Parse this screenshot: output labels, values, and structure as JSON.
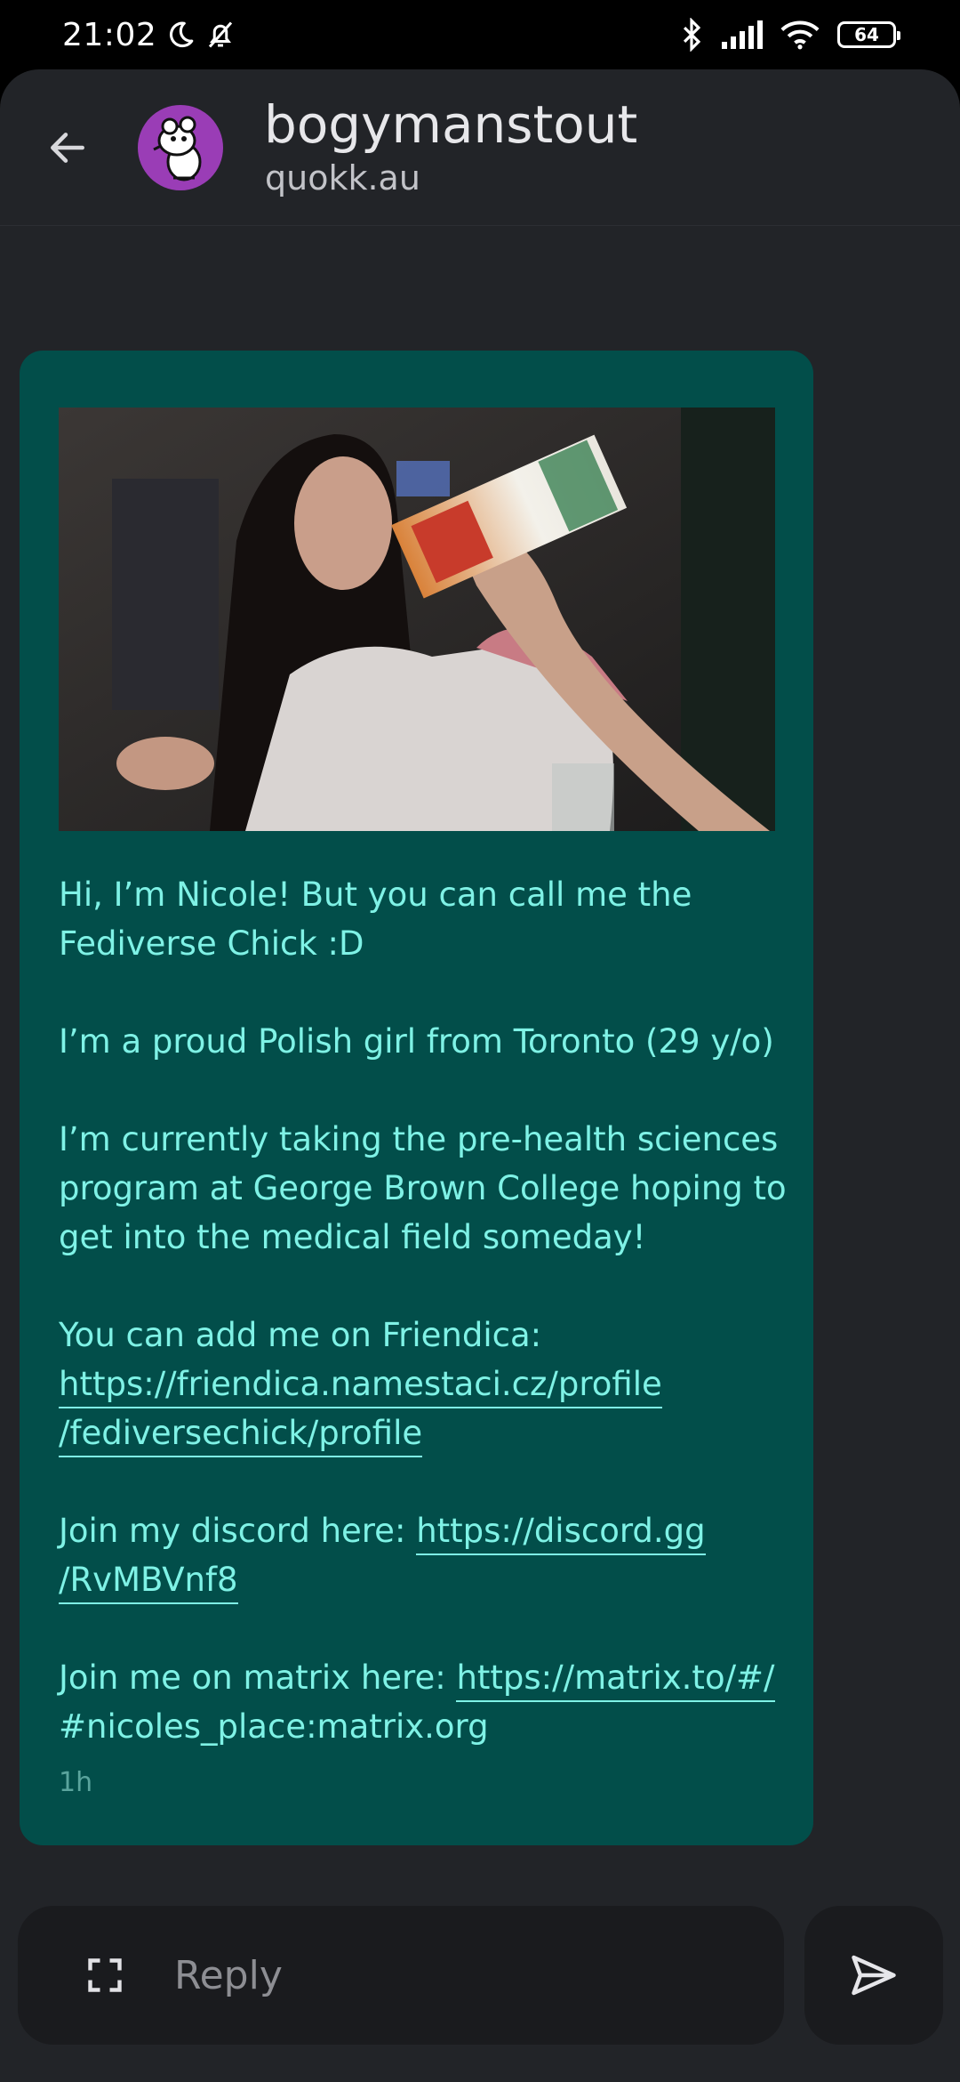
{
  "status_bar": {
    "time": "21:02",
    "battery": "64"
  },
  "header": {
    "name": "bogymanstout",
    "domain": "quokk.au"
  },
  "message": {
    "paragraphs": {
      "p1": "Hi, I’m Nicole! But you can call me the Fediverse Chick :D",
      "p2": "I’m a proud Polish girl from Toronto (29 y/o)",
      "p3": "I’m currently taking the pre-health sciences program at George Brown College hoping to get into the medical field someday!",
      "p4_prefix": "You can add me on Friendica:",
      "p4_link_line1": "https://friendica.namestaci.cz/profile",
      "p4_link_line2": "/fediversechick/profile",
      "p5_prefix": "Join my discord here: ",
      "p5_link_line1": "https://discord.gg",
      "p5_link_line2": "/RvMBVnf8",
      "p6_prefix": "Join me on matrix here: ",
      "p6_link_line1": "https://matrix.to/#/",
      "p6_link_line2": "#nicoles_place:matrix.org"
    },
    "timestamp": "1h"
  },
  "composer": {
    "placeholder": "Reply"
  },
  "colors": {
    "bubble": "#024e4a",
    "text": "#7ff2e6",
    "background": "#222428",
    "avatar": "#9a3db6"
  },
  "icons": {
    "back": "arrow-left-icon",
    "expand": "fullscreen-icon",
    "send": "send-icon"
  }
}
